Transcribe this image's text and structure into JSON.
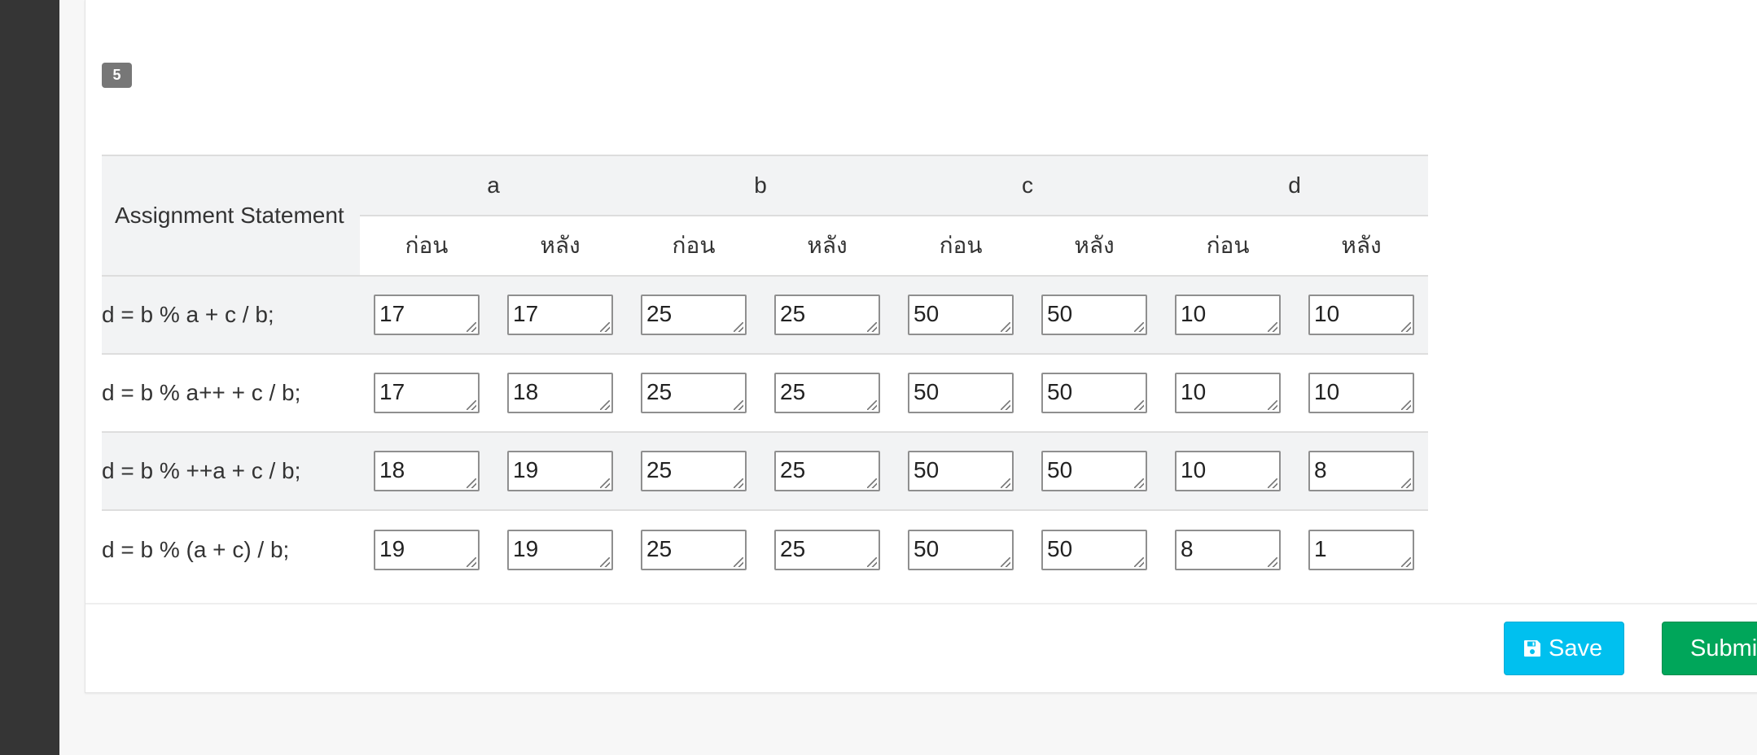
{
  "question_badge": "5",
  "table": {
    "statement_header": "Assignment Statement",
    "variables": [
      "a",
      "b",
      "c",
      "d"
    ],
    "before_label": "ก่อน",
    "after_label": "หลัง",
    "rows": [
      {
        "statement": "d = b % a + c / b;",
        "values": [
          "17",
          "17",
          "25",
          "25",
          "50",
          "50",
          "10",
          "10"
        ]
      },
      {
        "statement": "d = b % a++ + c / b;",
        "values": [
          "17",
          "18",
          "25",
          "25",
          "50",
          "50",
          "10",
          "10"
        ]
      },
      {
        "statement": "d = b % ++a + c / b;",
        "values": [
          "18",
          "19",
          "25",
          "25",
          "50",
          "50",
          "10",
          "8"
        ]
      },
      {
        "statement": "d = b % (a + c) / b;",
        "values": [
          "19",
          "19",
          "25",
          "25",
          "50",
          "50",
          "8",
          "1"
        ]
      }
    ]
  },
  "buttons": {
    "save_label": "Save",
    "submit_label": "Submit"
  },
  "colors": {
    "save": "#00c0ef",
    "submit": "#00a65a",
    "badge": "#777777",
    "sidebar": "#353535"
  }
}
